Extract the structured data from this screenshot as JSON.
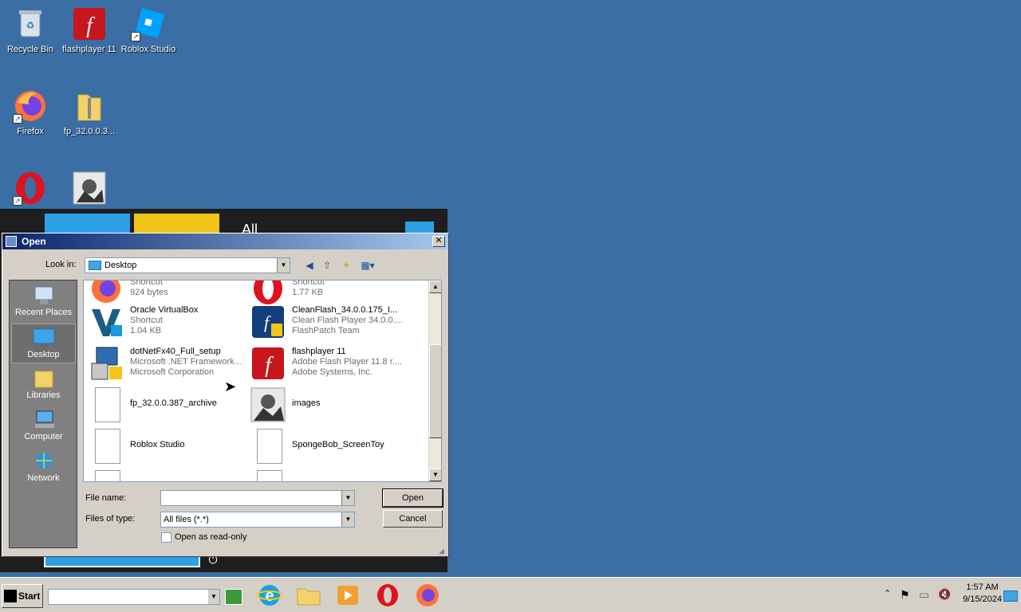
{
  "desktop": {
    "icons": [
      {
        "label": "Recycle Bin",
        "icon": "recycle-bin-icon"
      },
      {
        "label": "flashplayer 11",
        "icon": "flash-icon"
      },
      {
        "label": "Roblox Studio",
        "icon": "roblox-studio-icon"
      },
      {
        "label": "Firefox",
        "icon": "firefox-icon"
      },
      {
        "label": "fp_32.0.0.3...",
        "icon": "zip-folder-icon"
      },
      {
        "label": "",
        "icon": "opera-icon"
      },
      {
        "label": "",
        "icon": "image-icon"
      }
    ]
  },
  "background_menu": {
    "all_label": "All"
  },
  "dialog": {
    "title": "Open",
    "look_in_label": "Look in:",
    "look_in_value": "Desktop",
    "places": [
      {
        "label": "Recent Places",
        "icon": "recent-places-icon"
      },
      {
        "label": "Desktop",
        "icon": "desktop-icon"
      },
      {
        "label": "Libraries",
        "icon": "libraries-icon"
      },
      {
        "label": "Computer",
        "icon": "computer-icon"
      },
      {
        "label": "Network",
        "icon": "network-icon"
      }
    ],
    "files": [
      {
        "name": "Shortcut",
        "line2": "924 bytes",
        "line3": "",
        "icon": "firefox-icon"
      },
      {
        "name": "Shortcut",
        "line2": "1.77 KB",
        "line3": "",
        "icon": "opera-icon"
      },
      {
        "name": "Oracle VirtualBox",
        "line2": "Shortcut",
        "line3": "1.04 KB",
        "icon": "virtualbox-icon"
      },
      {
        "name": "CleanFlash_34.0.0.175_I...",
        "line2": "Clean Flash Player 34.0.0....",
        "line3": "FlashPatch Team",
        "icon": "cleanflash-icon"
      },
      {
        "name": "dotNetFx40_Full_setup",
        "line2": "Microsoft .NET Framework...",
        "line3": "Microsoft Corporation",
        "icon": "dotnet-setup-icon"
      },
      {
        "name": "flashplayer 11",
        "line2": "Adobe Flash Player 11.8 r....",
        "line3": "Adobe Systems, Inc.",
        "icon": "flash-icon"
      },
      {
        "name": "fp_32.0.0.387_archive",
        "line2": "",
        "line3": "",
        "icon": "blank-file-icon"
      },
      {
        "name": "images",
        "line2": "",
        "line3": "",
        "icon": "image-icon"
      },
      {
        "name": "Roblox Studio",
        "line2": "",
        "line3": "",
        "icon": "blank-file-icon"
      },
      {
        "name": "SpongeBob_ScreenToy",
        "line2": "",
        "line3": "",
        "icon": "blank-file-icon"
      }
    ],
    "file_name_label": "File name:",
    "file_name_value": "",
    "files_of_type_label": "Files of type:",
    "files_of_type_value": "All files (*.*)",
    "open_button": "Open",
    "cancel_button": "Cancel",
    "read_only_label": "Open as read-only"
  },
  "taskbar": {
    "start_label": "Start",
    "clock_time": "1:57 AM",
    "clock_date": "9/15/2024",
    "quick_launch": [
      "ie-icon",
      "folder-icon",
      "media-player-icon",
      "opera-icon",
      "firefox-icon"
    ]
  },
  "colors": {
    "desktop": "#3a6ea5",
    "dialog": "#d4d0c8",
    "title_start": "#0a246a",
    "title_end": "#a6caf0"
  }
}
